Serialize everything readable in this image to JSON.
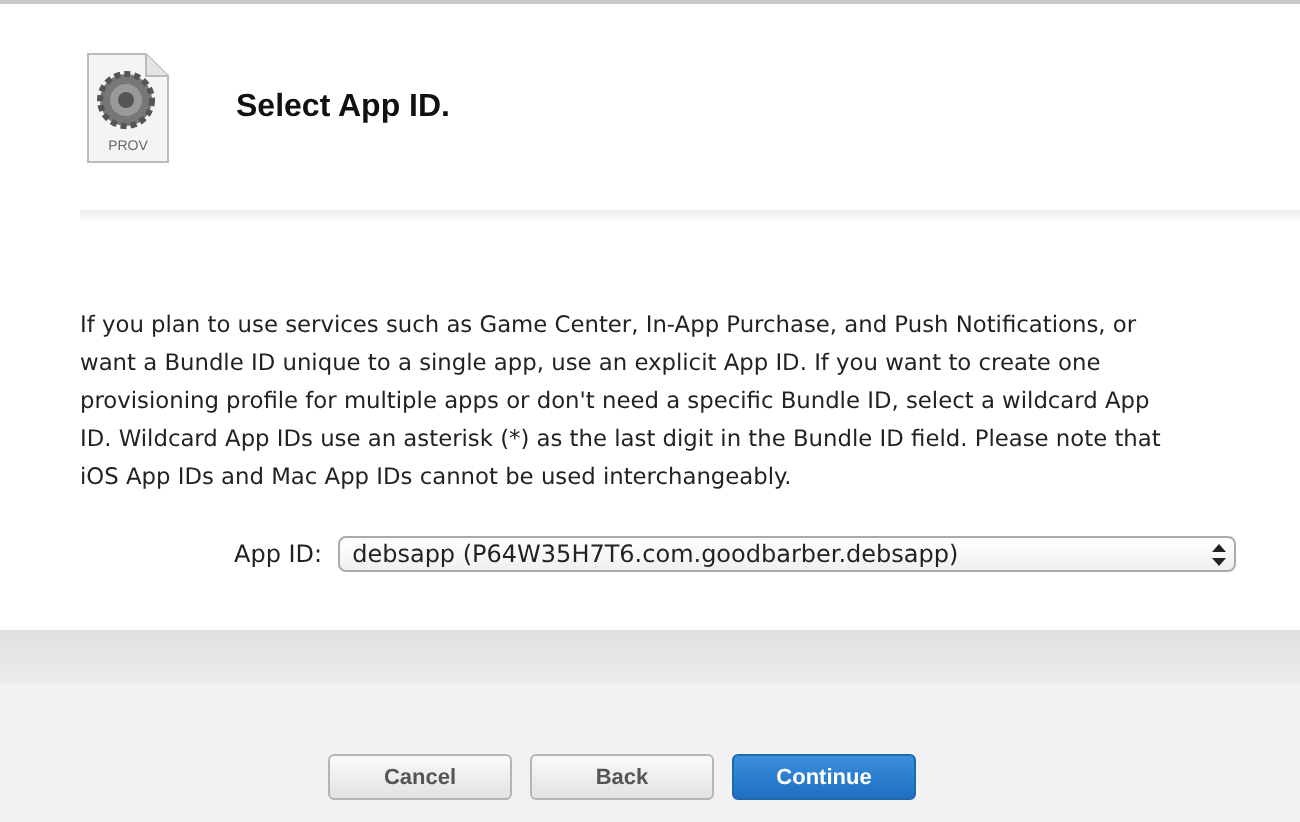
{
  "header": {
    "icon_label": "PROV",
    "title": "Select App ID."
  },
  "description": "If you plan to use services such as Game Center, In-App Purchase, and Push Notifications, or want a Bundle ID unique to a single app, use an explicit App ID. If you want to create one provisioning profile for multiple apps or don't need a specific Bundle ID, select a wildcard App ID. Wildcard App IDs use an asterisk (*) as the last digit in the Bundle ID field. Please note that iOS App IDs and Mac App IDs cannot be used interchangeably.",
  "app_id": {
    "label": "App ID:",
    "value": "debsapp (P64W35H7T6.com.goodbarber.debsapp)"
  },
  "buttons": [
    {
      "label": "Cancel",
      "kind": "secondary"
    },
    {
      "label": "Back",
      "kind": "secondary"
    },
    {
      "label": "Continue",
      "kind": "primary"
    }
  ]
}
